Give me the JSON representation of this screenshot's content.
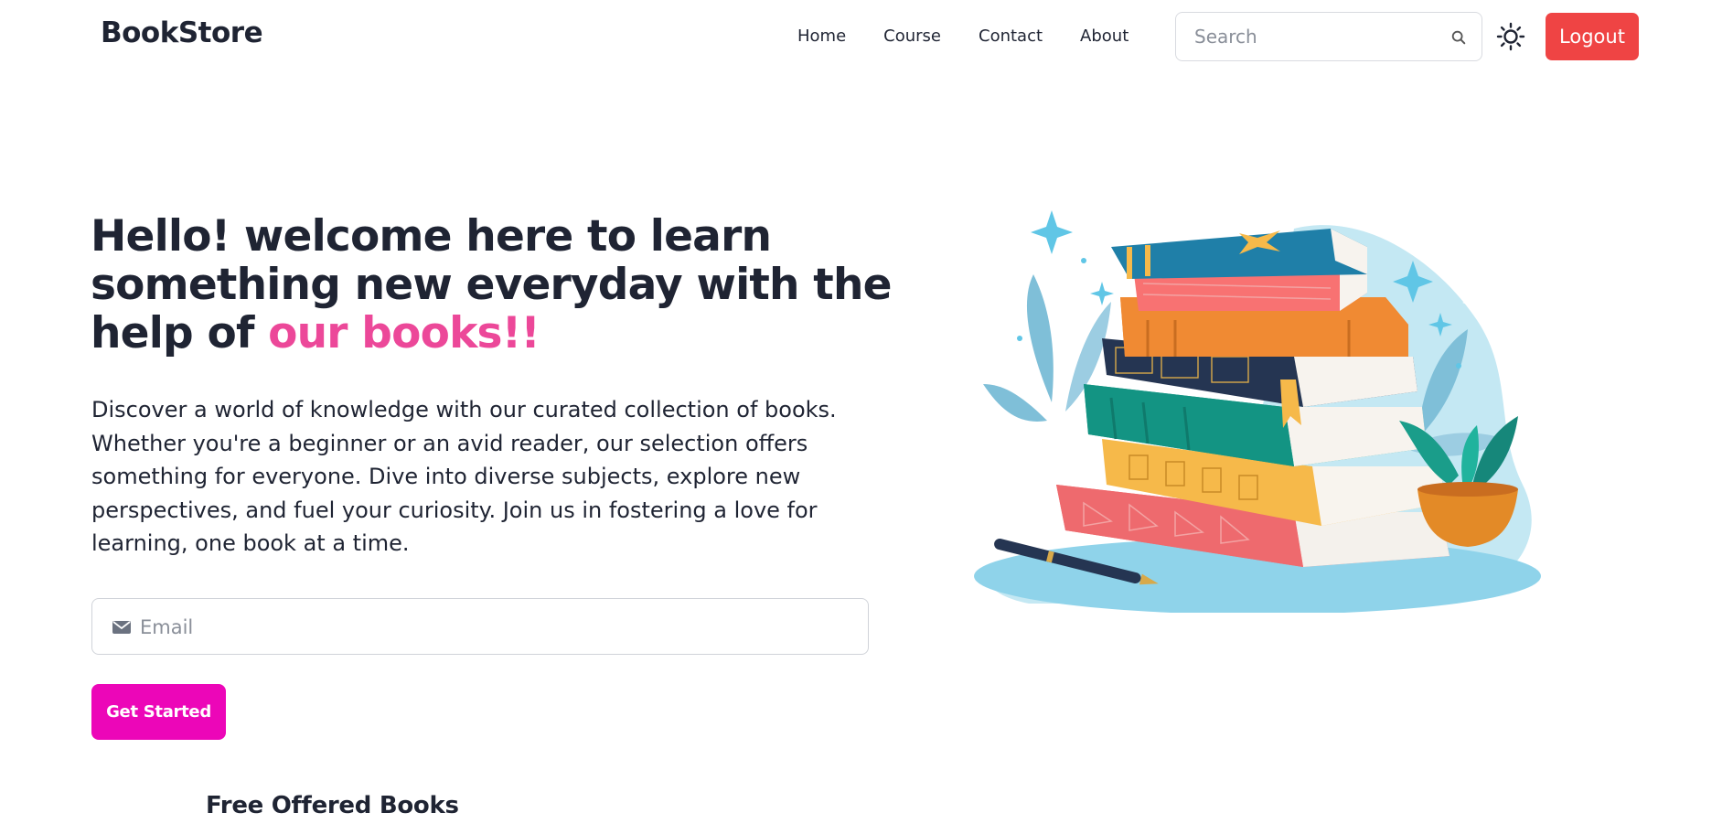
{
  "nav": {
    "brand": "BookStore",
    "items": [
      {
        "label": "Home"
      },
      {
        "label": "Course"
      },
      {
        "label": "Contact"
      },
      {
        "label": "About"
      }
    ],
    "search": {
      "placeholder": "Search",
      "icon": "search-icon"
    },
    "theme_icon": "sun-icon",
    "logout_label": "Logout"
  },
  "hero": {
    "title_main": "Hello! welcome here to learn something new everyday with the help of ",
    "title_highlight": "our books!!",
    "description": "Discover a world of knowledge with our curated collection of books. Whether you're a beginner or an avid reader, our selection offers something for everyone. Dive into diverse subjects, explore new perspectives, and fuel your curiosity. Join us in fostering a love for learning, one book at a time.",
    "email": {
      "placeholder": "Email",
      "icon": "mail-icon"
    },
    "cta_label": "Get Started"
  },
  "section": {
    "title": "Free Offered Books",
    "subtitle": ""
  },
  "colors": {
    "text": "#1f2433",
    "highlight": "#ec4899",
    "logout": "#ef4444",
    "cta": "#ec06b8"
  }
}
